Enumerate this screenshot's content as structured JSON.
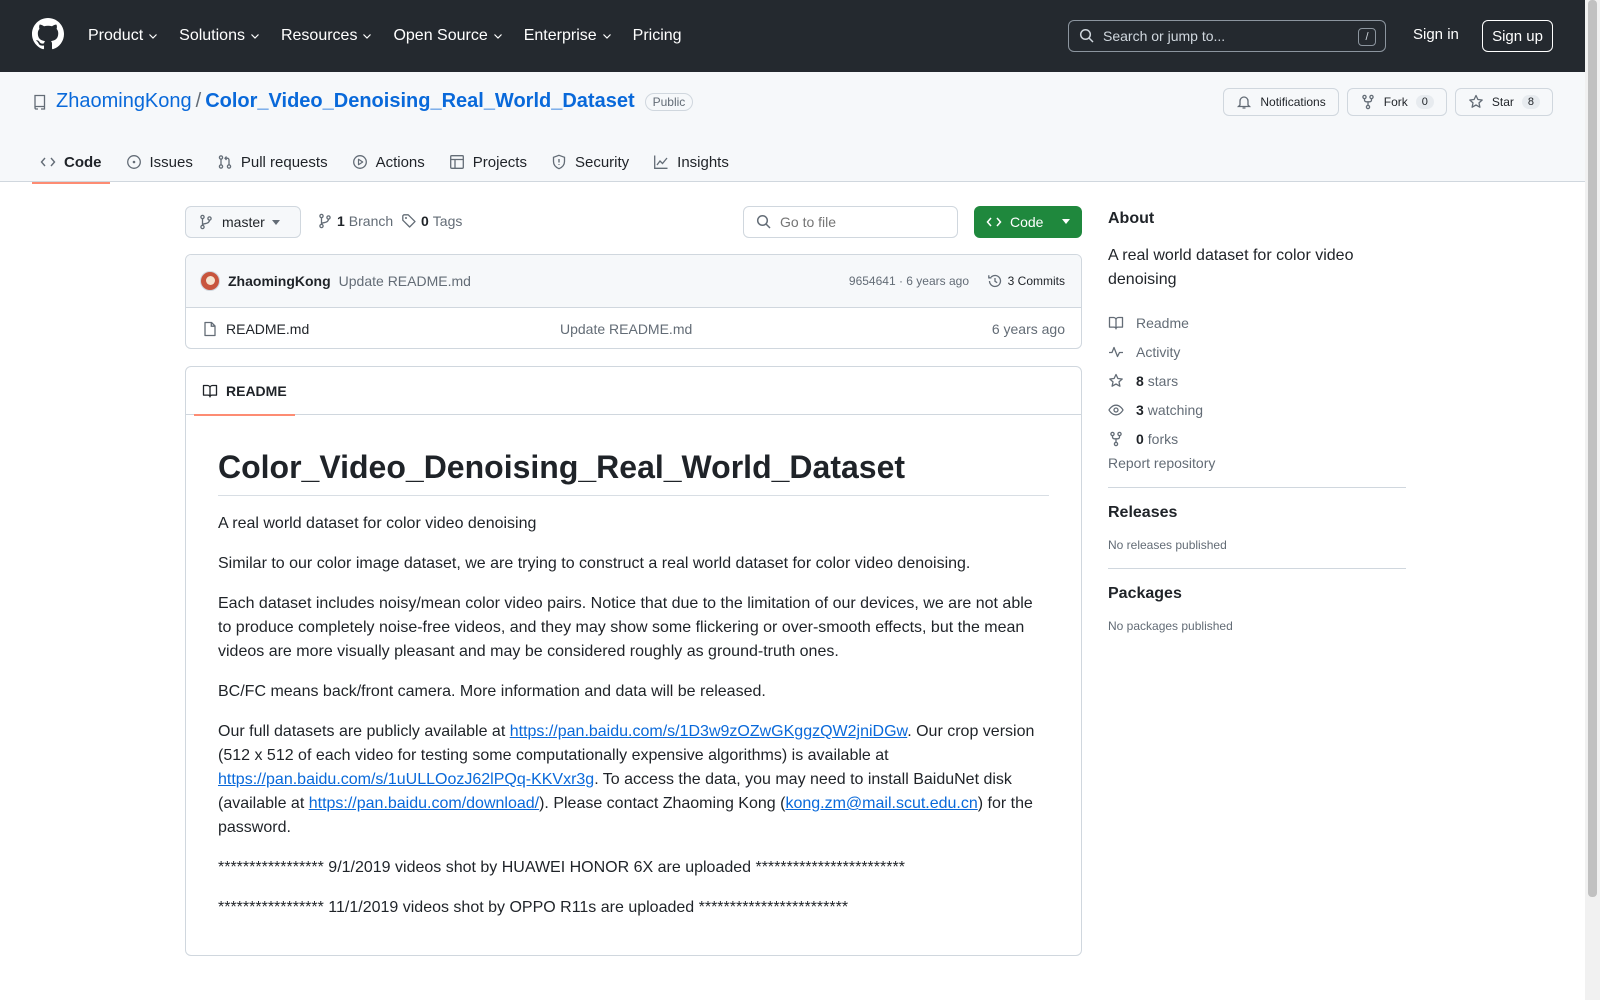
{
  "topnav": {
    "items": [
      {
        "label": "Product",
        "caret": true
      },
      {
        "label": "Solutions",
        "caret": true
      },
      {
        "label": "Resources",
        "caret": true
      },
      {
        "label": "Open Source",
        "caret": true
      },
      {
        "label": "Enterprise",
        "caret": true
      },
      {
        "label": "Pricing",
        "caret": false
      }
    ],
    "search_placeholder": "Search or jump to...",
    "search_shortcut": "/",
    "signin": "Sign in",
    "signup": "Sign up"
  },
  "repo": {
    "owner": "ZhaomingKong",
    "separator": "/",
    "name": "Color_Video_Denoising_Real_World_Dataset",
    "visibility": "Public",
    "notifications": "Notifications",
    "fork_label": "Fork",
    "fork_count": "0",
    "star_label": "Star",
    "star_count": "8"
  },
  "tabs": [
    {
      "label": "Code",
      "icon": "code-icon",
      "active": true
    },
    {
      "label": "Issues",
      "icon": "issue-icon",
      "active": false
    },
    {
      "label": "Pull requests",
      "icon": "pull-request-icon",
      "active": false
    },
    {
      "label": "Actions",
      "icon": "play-icon",
      "active": false
    },
    {
      "label": "Projects",
      "icon": "table-icon",
      "active": false
    },
    {
      "label": "Security",
      "icon": "shield-icon",
      "active": false
    },
    {
      "label": "Insights",
      "icon": "graph-icon",
      "active": false
    }
  ],
  "toolbar": {
    "branch": "master",
    "branch_count": "1",
    "branch_label": "Branch",
    "tag_count": "0",
    "tag_label": "Tags",
    "goto_placeholder": "Go to file",
    "code_button": "Code"
  },
  "commit": {
    "author": "ZhaomingKong",
    "message": "Update README.md",
    "meta": "9654641 · 6 years ago",
    "commits": "3 Commits"
  },
  "files": [
    {
      "name": "README.md",
      "message": "Update README.md",
      "time": "6 years ago"
    }
  ],
  "readme": {
    "tab": "README",
    "title": "Color_Video_Denoising_Real_World_Dataset",
    "p1": "A real world dataset for color video denoising",
    "p2": "Similar to our color image dataset, we are trying to construct a real world dataset for color video denoising.",
    "p3": "Each dataset includes noisy/mean color video pairs. Notice that due to the limitation of our devices, we are not able to produce completely noise-free videos, and they may show some flickering or over-smooth effects, but the mean videos are more visually pleasant and may be considered roughly as ground-truth ones.",
    "p4": "BC/FC means back/front camera. More information and data will be released.",
    "p5_t1": "Our full datasets are publicly available at ",
    "p5_link1": "https://pan.baidu.com/s/1D3w9zOZwGKggzQW2jniDGw",
    "p5_t2": ". Our crop version (512 x 512 of each video for testing some computationally expensive algorithms) is available at ",
    "p5_link2": "https://pan.baidu.com/s/1uULLOozJ62lPQq-KKVxr3g",
    "p5_t3": ". To access the data, you may need to install BaiduNet disk (available at ",
    "p5_link3": "https://pan.baidu.com/download/",
    "p5_t4": "). Please contact Zhaoming Kong (",
    "p5_link4": "kong.zm@mail.scut.edu.cn",
    "p5_t5": ") for the password.",
    "p6": "***************** 9/1/2019 videos shot by HUAWEI HONOR 6X are uploaded ************************",
    "p7": "***************** 11/1/2019 videos shot by OPPO R11s are uploaded ************************"
  },
  "about": {
    "heading": "About",
    "description": "A real world dataset for color video denoising",
    "items": [
      {
        "icon": "book-icon",
        "count": "",
        "label": "Readme"
      },
      {
        "icon": "pulse-icon",
        "count": "",
        "label": "Activity"
      },
      {
        "icon": "star-icon",
        "count": "8",
        "label": "stars"
      },
      {
        "icon": "eye-icon",
        "count": "3",
        "label": "watching"
      },
      {
        "icon": "fork-icon",
        "count": "0",
        "label": "forks"
      }
    ],
    "report": "Report repository"
  },
  "releases": {
    "heading": "Releases",
    "empty": "No releases published"
  },
  "packages": {
    "heading": "Packages",
    "empty": "No packages published"
  }
}
